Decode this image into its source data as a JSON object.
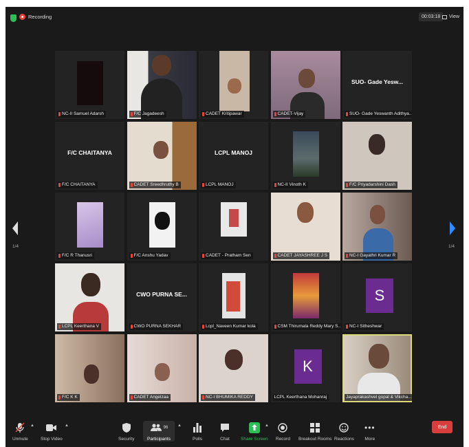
{
  "topbar": {
    "recording_label": "Recording",
    "timer": "00:03:18",
    "view_label": "View"
  },
  "pager": {
    "left": "1/4",
    "right": "1/4"
  },
  "tiles": [
    {
      "name": "NC-II Samuel Adarsh"
    },
    {
      "name": "F/C Jagadeesh"
    },
    {
      "name": "CADET Kritipawar"
    },
    {
      "name": "CADET-Vijay"
    },
    {
      "name": "SUO- Gade Yeswanth Adithya...",
      "display": "SUO- Gade Yesw..."
    },
    {
      "name": "F/C CHAITANYA",
      "display": "F/C CHAITANYA"
    },
    {
      "name": "CADET Sreedhruthy B"
    },
    {
      "name": "LCPL MANOJ",
      "display": "LCPL MANOJ"
    },
    {
      "name": "NC-II Vinoth K"
    },
    {
      "name": "F/C Priyadarshini Dash"
    },
    {
      "name": "F/C R Thanusri"
    },
    {
      "name": "F/C Anshu Yadav"
    },
    {
      "name": "CADET - Pratham Sen"
    },
    {
      "name": "CADET JAYASHREE J S"
    },
    {
      "name": "NC-I Gayathri Kumar R"
    },
    {
      "name": "LCPL Keerthana V"
    },
    {
      "name": "CWO PURNA SEKHAR",
      "display": "CWO PURNA SE..."
    },
    {
      "name": "Lcpl_Naveen Kumar kola"
    },
    {
      "name": "CSM Thirumala Reddy Mary S..."
    },
    {
      "name": "NC-I Sitheshwar",
      "letter": "S"
    },
    {
      "name": "F/C K K"
    },
    {
      "name": "CADET Angelzaa"
    },
    {
      "name": "NC-I BHUMIKA REDDY"
    },
    {
      "name": "LCPL Keerthana Mohanraj",
      "letter": "K"
    },
    {
      "name": "Jayaprakashvel gopal & Vikcha..."
    }
  ],
  "toolbar": {
    "unmute": "Unmute",
    "stop_video": "Stop Video",
    "security": "Security",
    "participants": "Participants",
    "participants_count": "96",
    "polls": "Polls",
    "chat": "Chat",
    "share_screen": "Share Screen",
    "record": "Record",
    "breakout": "Breakout Rooms",
    "reactions": "Reactions",
    "more": "More",
    "end": "End"
  },
  "colors": {
    "accent_blue": "#2d8cff",
    "share_green": "#2dbf57",
    "end_red": "#d93e3e",
    "active_speaker": "#d9db7a",
    "letter_avatar": "#6b2c91"
  }
}
